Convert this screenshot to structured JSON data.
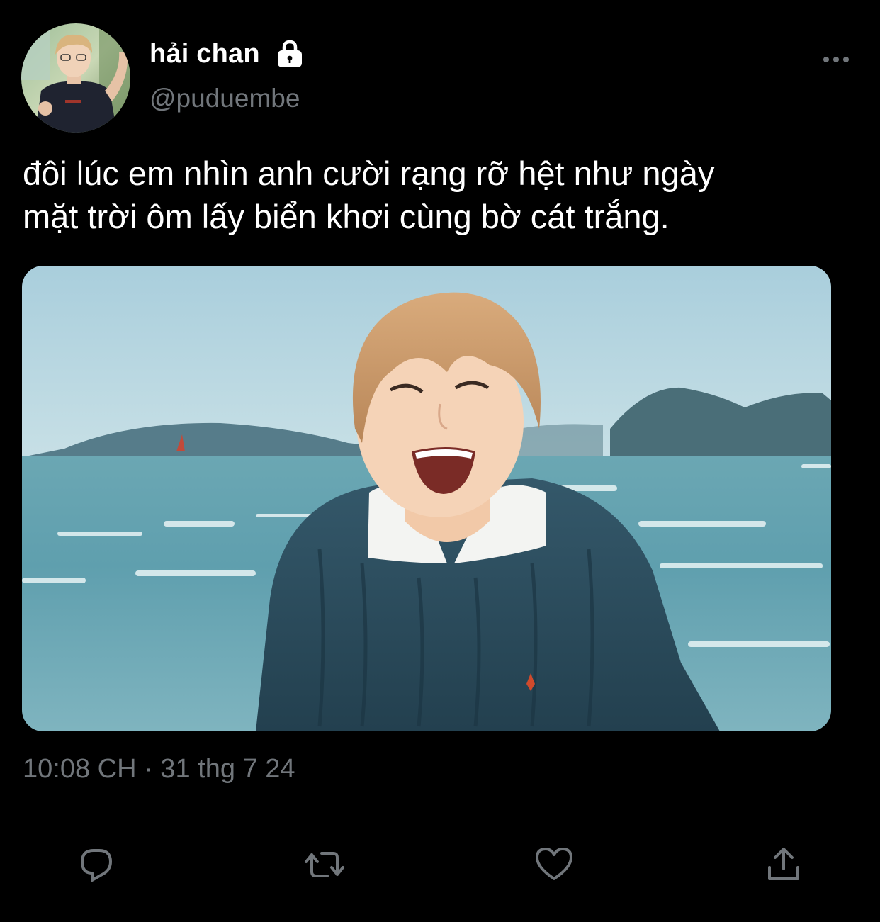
{
  "author": {
    "display_name": "hải chan",
    "handle": "@puduembe",
    "protected": true
  },
  "tweet": {
    "text_lines": [
      "đôi lúc em nhìn anh cười rạng rỡ hệt như ngày",
      "mặt trời ôm lấy biển khơi cùng bờ cát trắng."
    ],
    "timestamp": "10:08 CH · 31 thg 7 24",
    "media": {
      "type": "photo"
    }
  },
  "actions": [
    {
      "name": "reply",
      "icon": "reply-icon"
    },
    {
      "name": "retweet",
      "icon": "retweet-icon"
    },
    {
      "name": "like",
      "icon": "heart-icon"
    },
    {
      "name": "share",
      "icon": "share-icon"
    }
  ],
  "colors": {
    "background": "#000000",
    "text": "#ffffff",
    "secondary_text": "#71767b",
    "divider": "#2f3336"
  }
}
